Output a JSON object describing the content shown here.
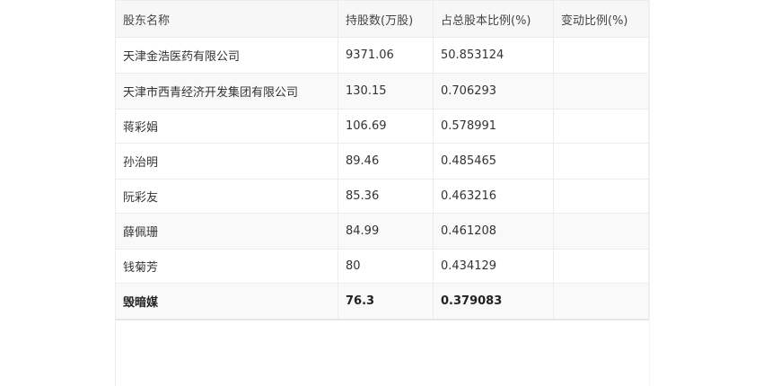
{
  "table": {
    "headers": {
      "name": "股东名称",
      "shares": "持股数(万股)",
      "ratio": "占总股本比例(%)",
      "change": "变动比例(%)"
    },
    "rows": [
      {
        "name": "天津金浩医药有限公司",
        "shares": "9371.06",
        "ratio": "50.853124",
        "change": ""
      },
      {
        "name": "天津市西青经济开发集团有限公司",
        "shares": "130.15",
        "ratio": "0.706293",
        "change": ""
      },
      {
        "name": "蒋彩娟",
        "shares": "106.69",
        "ratio": "0.578991",
        "change": ""
      },
      {
        "name": "孙治明",
        "shares": "89.46",
        "ratio": "0.485465",
        "change": ""
      },
      {
        "name": "阮彩友",
        "shares": "85.36",
        "ratio": "0.463216",
        "change": ""
      },
      {
        "name": "薛佩珊",
        "shares": "84.99",
        "ratio": "0.461208",
        "change": ""
      },
      {
        "name": "钱菊芳",
        "shares": "80",
        "ratio": "0.434129",
        "change": ""
      },
      {
        "name": "毁暗媒",
        "shares": "76.3",
        "ratio": "0.379083",
        "change": ""
      }
    ]
  }
}
